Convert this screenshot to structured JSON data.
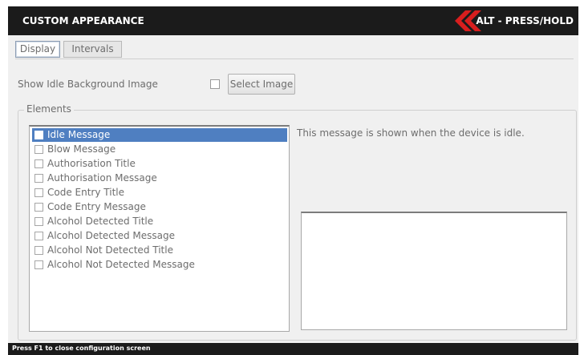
{
  "window": {
    "title": "CUSTOM APPEARANCE",
    "shortcut_hint": "ALT - PRESS/HOLD"
  },
  "tabs": [
    {
      "label": "Display",
      "active": true
    },
    {
      "label": "Intervals",
      "active": false
    }
  ],
  "display": {
    "idle_bg_label": "Show Idle Background Image",
    "idle_bg_checked": false,
    "select_image_label": "Select Image",
    "elements_group_label": "Elements",
    "elements": [
      {
        "label": "Idle Message",
        "checked": false,
        "selected": true
      },
      {
        "label": "Blow Message",
        "checked": false,
        "selected": false
      },
      {
        "label": "Authorisation Title",
        "checked": false,
        "selected": false
      },
      {
        "label": "Authorisation Message",
        "checked": false,
        "selected": false
      },
      {
        "label": "Code Entry Title",
        "checked": false,
        "selected": false
      },
      {
        "label": "Code Entry Message",
        "checked": false,
        "selected": false
      },
      {
        "label": "Alcohol Detected Title",
        "checked": false,
        "selected": false
      },
      {
        "label": "Alcohol Detected Message",
        "checked": false,
        "selected": false
      },
      {
        "label": "Alcohol Not Detected Title",
        "checked": false,
        "selected": false
      },
      {
        "label": "Alcohol Not Detected Message",
        "checked": false,
        "selected": false
      }
    ],
    "description": "This message is shown when the device is idle.",
    "preview_text": ""
  },
  "status_bar": {
    "text": "Press F1 to close configuration screen"
  },
  "colors": {
    "titlebar_bg": "#1b1b1b",
    "panel_bg": "#f0f0f0",
    "selection": "#4f7fc1",
    "logo_red": "#d81e1e"
  },
  "icons": {
    "logo": "double-chevron-left-logo"
  }
}
